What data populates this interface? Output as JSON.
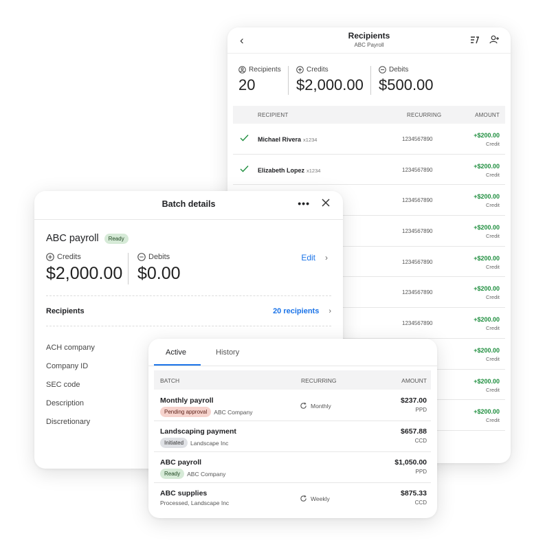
{
  "recipients_panel": {
    "title": "Recipients",
    "subtitle": "ABC Payroll",
    "summary": {
      "recipients_label": "Recipients",
      "recipients_value": "20",
      "credits_label": "Credits",
      "credits_value": "$2,000.00",
      "debits_label": "Debits",
      "debits_value": "$500.00"
    },
    "columns": {
      "recipient": "RECIPIENT",
      "recurring": "RECURRING",
      "amount": "AMOUNT"
    },
    "rows": [
      {
        "name": "Michael Rivera",
        "acct": "x1234",
        "recurring": "1234567890",
        "amount": "+$200.00",
        "type": "Credit",
        "checked": true
      },
      {
        "name": "Elizabeth Lopez",
        "acct": "x1234",
        "recurring": "1234567890",
        "amount": "+$200.00",
        "type": "Credit",
        "checked": true
      },
      {
        "name": "",
        "acct": "",
        "recurring": "1234567890",
        "amount": "+$200.00",
        "type": "Credit",
        "checked": false
      },
      {
        "name": "",
        "acct": "",
        "recurring": "1234567890",
        "amount": "+$200.00",
        "type": "Credit",
        "checked": false
      },
      {
        "name": "",
        "acct": "",
        "recurring": "1234567890",
        "amount": "+$200.00",
        "type": "Credit",
        "checked": false
      },
      {
        "name": "",
        "acct": "",
        "recurring": "1234567890",
        "amount": "+$200.00",
        "type": "Credit",
        "checked": false
      },
      {
        "name": "",
        "acct": "",
        "recurring": "1234567890",
        "amount": "+$200.00",
        "type": "Credit",
        "checked": false
      },
      {
        "name": "",
        "acct": "",
        "recurring": "",
        "amount": "+$200.00",
        "type": "Credit",
        "checked": false
      },
      {
        "name": "",
        "acct": "",
        "recurring": "",
        "amount": "+$200.00",
        "type": "Credit",
        "checked": false
      },
      {
        "name": "",
        "acct": "",
        "recurring": "",
        "amount": "+$200.00",
        "type": "Credit",
        "checked": false
      }
    ]
  },
  "batch_details": {
    "title": "Batch details",
    "more_label": "•••",
    "batch_name": "ABC payroll",
    "status": "Ready",
    "credits_label": "Credits",
    "credits_value": "$2,000.00",
    "debits_label": "Debits",
    "debits_value": "$0.00",
    "edit_label": "Edit",
    "recipients_label": "Recipients",
    "recipients_link": "20 recipients",
    "fields": [
      "ACH company",
      "Company ID",
      "SEC code",
      "Description",
      "Discretionary"
    ]
  },
  "batch_list": {
    "tabs": [
      "Active",
      "History"
    ],
    "columns": {
      "batch": "BATCH",
      "recurring": "RECURRING",
      "amount": "AMOUNT"
    },
    "rows": [
      {
        "name": "Monthly payroll",
        "status": "Pending approval",
        "status_kind": "pending",
        "company": "ABC Company",
        "recurring": "Monthly",
        "amount": "$237.00",
        "code": "PPD"
      },
      {
        "name": "Landscaping payment",
        "status": "Initiated",
        "status_kind": "init",
        "company": "Landscape Inc",
        "recurring": "",
        "amount": "$657.88",
        "code": "CCD"
      },
      {
        "name": "ABC payroll",
        "status": "Ready",
        "status_kind": "ready",
        "company": "ABC Company",
        "recurring": "",
        "amount": "$1,050.00",
        "code": "PPD"
      },
      {
        "name": "ABC supplies",
        "status": "",
        "status_kind": "none",
        "company": "Processed, Landscape Inc",
        "recurring": "Weekly",
        "amount": "$875.33",
        "code": "CCD"
      }
    ]
  },
  "colors": {
    "accent": "#1a73e8",
    "credit_green": "#1e8e3e",
    "ready_badge": "#d6ead7",
    "pending_badge": "#f6d3cd",
    "initiated_badge": "#dfe1e5"
  }
}
